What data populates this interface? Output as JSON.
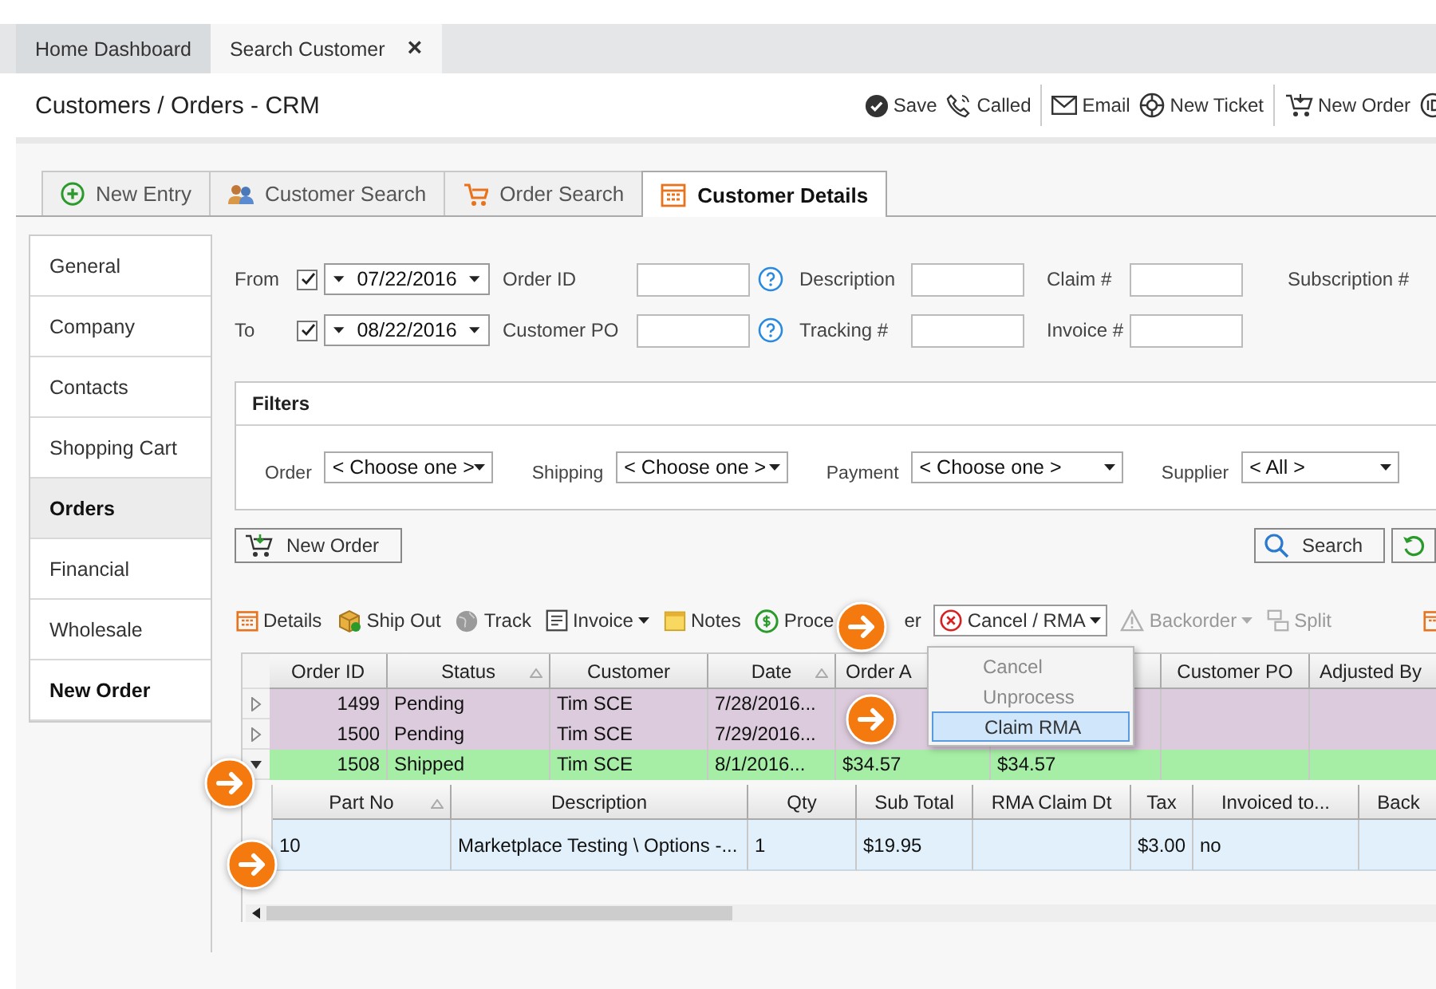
{
  "doc_tabs": [
    {
      "label": "Home Dashboard",
      "selected": false,
      "closable": false
    },
    {
      "label": "Search Customer",
      "selected": true,
      "closable": true
    }
  ],
  "close_glyph": "×",
  "title": "Customers / Orders - CRM",
  "toolbar": [
    {
      "label": "Save"
    },
    {
      "label": "Called"
    },
    {
      "label": "Email"
    },
    {
      "label": "New Ticket"
    },
    {
      "label": "New Order"
    }
  ],
  "section_tabs": [
    {
      "label": "New Entry",
      "selected": false
    },
    {
      "label": "Customer Search",
      "selected": false
    },
    {
      "label": "Order Search",
      "selected": false
    },
    {
      "label": "Customer Details",
      "selected": true
    }
  ],
  "sidebar": [
    {
      "label": "General",
      "selected": false,
      "emphasized": false
    },
    {
      "label": "Company",
      "selected": false,
      "emphasized": false
    },
    {
      "label": "Contacts",
      "selected": false,
      "emphasized": false
    },
    {
      "label": "Shopping Cart",
      "selected": false,
      "emphasized": false
    },
    {
      "label": "Orders",
      "selected": true,
      "emphasized": true
    },
    {
      "label": "Financial",
      "selected": false,
      "emphasized": false
    },
    {
      "label": "Wholesale",
      "selected": false,
      "emphasized": false
    },
    {
      "label": "New Order",
      "selected": false,
      "emphasized": true
    }
  ],
  "criteria": {
    "from": {
      "label": "From",
      "checked": true,
      "value": "07/22/2016"
    },
    "to": {
      "label": "To",
      "checked": true,
      "value": "08/22/2016"
    },
    "row1": [
      {
        "label": "Order ID",
        "help": true,
        "field": true
      },
      {
        "label": "Description",
        "help": false,
        "field": true
      },
      {
        "label": "Claim #",
        "help": false,
        "field": true
      },
      {
        "label": "Subscription #",
        "help": false,
        "field": false
      }
    ],
    "row2": [
      {
        "label": "Customer PO",
        "help": true,
        "field": true
      },
      {
        "label": "Tracking #",
        "help": false,
        "field": true
      },
      {
        "label": "Invoice #",
        "help": false,
        "field": true
      }
    ]
  },
  "filters": {
    "title": "Filters",
    "items": [
      {
        "label": "Order",
        "value": "< Choose one >"
      },
      {
        "label": "Shipping",
        "value": "< Choose one >"
      },
      {
        "label": "Payment",
        "value": "< Choose one >"
      },
      {
        "label": "Supplier",
        "value": "< All >"
      }
    ]
  },
  "new_order_button": "New Order",
  "search_button": "Search",
  "actions": [
    {
      "label": "Details",
      "dropdown": false,
      "disabled": false
    },
    {
      "label": "Ship Out",
      "dropdown": false,
      "disabled": false
    },
    {
      "label": "Track",
      "dropdown": false,
      "disabled": false
    },
    {
      "label": "Invoice",
      "dropdown": true,
      "disabled": false
    },
    {
      "label": "Notes",
      "dropdown": false,
      "disabled": false
    },
    {
      "label": "Proce",
      "label_end": "er",
      "dropdown": false,
      "disabled": false
    },
    {
      "label": "Cancel / RMA",
      "dropdown": true,
      "disabled": false
    },
    {
      "label": "Backorder",
      "dropdown": true,
      "disabled": true
    },
    {
      "label": "Split",
      "dropdown": false,
      "disabled": true
    }
  ],
  "menu": [
    {
      "label": "Cancel",
      "disabled": true,
      "selected": false
    },
    {
      "label": "Unprocess",
      "disabled": true,
      "selected": false
    },
    {
      "label": "Claim RMA",
      "disabled": false,
      "selected": true
    }
  ],
  "orders": {
    "columns": [
      {
        "label": "Order ID",
        "sorted": false
      },
      {
        "label": "Status",
        "sorted": true
      },
      {
        "label": "Customer",
        "sorted": false
      },
      {
        "label": "Date",
        "sorted": true
      },
      {
        "label": "Order A",
        "sorted": false
      },
      {
        "sorted": false
      },
      {
        "label": "Customer PO",
        "sorted": false
      },
      {
        "label": "Adjusted By",
        "sorted": false
      }
    ],
    "rows": [
      {
        "expanded": false,
        "color": "#dccbdc",
        "cells": [
          "1499",
          "Pending",
          "Tim SCE",
          "7/28/2016...",
          "",
          "",
          "",
          ""
        ]
      },
      {
        "expanded": false,
        "color": "#dccbdc",
        "cells": [
          "1500",
          "Pending",
          "Tim SCE",
          "7/29/2016...",
          "",
          "",
          "",
          ""
        ]
      },
      {
        "expanded": true,
        "color": "#a6eea6",
        "cells": [
          "1508",
          "Shipped",
          "Tim SCE",
          "8/1/2016...",
          "$34.57",
          "$34.57",
          "",
          ""
        ]
      }
    ]
  },
  "details": {
    "columns": [
      {
        "label": "Part No",
        "sorted": true
      },
      {
        "label": "Description",
        "sorted": false
      },
      {
        "label": "Qty",
        "sorted": false
      },
      {
        "label": "Sub Total",
        "sorted": false
      },
      {
        "label": "RMA Claim Dt",
        "sorted": false
      },
      {
        "label": "Tax",
        "sorted": false
      },
      {
        "label": "Invoiced to...",
        "sorted": false
      },
      {
        "label": "Back",
        "sorted": false
      }
    ],
    "rows": [
      {
        "cells": [
          "10",
          "Marketplace Testing \\ Options -...",
          "1",
          "$19.95",
          "",
          "$3.00",
          "no",
          ""
        ]
      }
    ]
  }
}
